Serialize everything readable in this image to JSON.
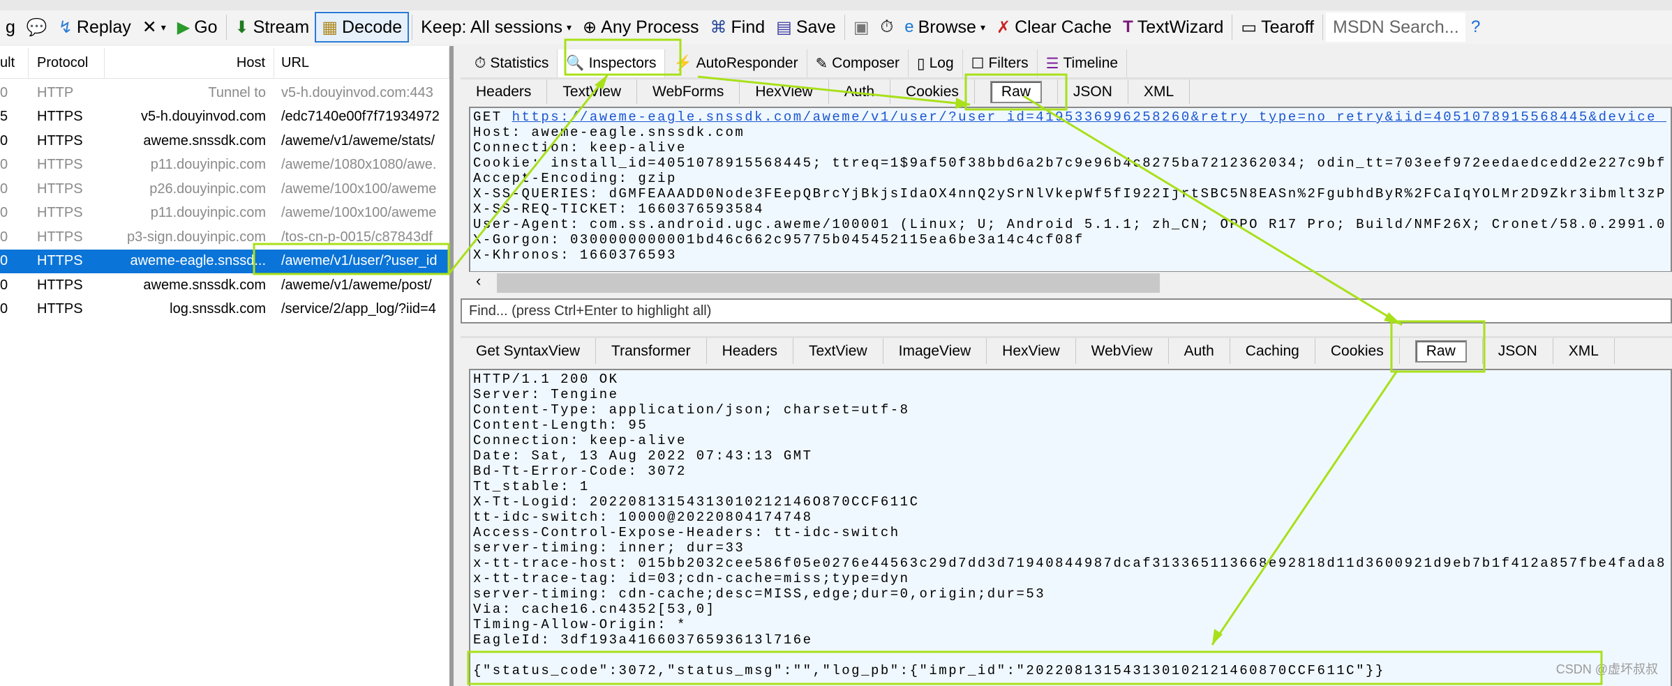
{
  "toolbar": {
    "items": [
      {
        "label": "Replay",
        "icon": "replay-icon"
      },
      {
        "label": "Go",
        "icon": "play-icon"
      },
      {
        "label": "Stream",
        "icon": "stream-icon"
      },
      {
        "label": "Decode",
        "icon": "decode-icon"
      },
      {
        "label": "Keep: All sessions"
      },
      {
        "label": "Any Process",
        "icon": "crosshair-icon"
      },
      {
        "label": "Find",
        "icon": "binoculars-icon"
      },
      {
        "label": "Save",
        "icon": "save-icon"
      },
      {
        "label": "Browse",
        "icon": "ie-icon"
      },
      {
        "label": "Clear Cache",
        "icon": "clear-cache-icon"
      },
      {
        "label": "TextWizard",
        "icon": "textwizard-icon"
      },
      {
        "label": "Tearoff",
        "icon": "tearoff-icon"
      }
    ],
    "partial_g": "g",
    "remove_label": "✕",
    "search_placeholder": "MSDN Search..."
  },
  "sessions": {
    "columns": [
      "ult",
      "Protocol",
      "Host",
      "URL"
    ],
    "rows": [
      {
        "result": "0",
        "protocol": "HTTP",
        "host": "Tunnel to",
        "url": "v5-h.douyinvod.com:443",
        "muted": true
      },
      {
        "result": "5",
        "protocol": "HTTPS",
        "host": "v5-h.douyinvod.com",
        "url": "/edc7140e00f7f71934972",
        "muted": false
      },
      {
        "result": "0",
        "protocol": "HTTPS",
        "host": "aweme.snssdk.com",
        "url": "/aweme/v1/aweme/stats/",
        "muted": false
      },
      {
        "result": "0",
        "protocol": "HTTPS",
        "host": "p11.douyinpic.com",
        "url": "/aweme/1080x1080/awe.",
        "muted": true
      },
      {
        "result": "0",
        "protocol": "HTTPS",
        "host": "p26.douyinpic.com",
        "url": "/aweme/100x100/aweme",
        "muted": true
      },
      {
        "result": "0",
        "protocol": "HTTPS",
        "host": "p11.douyinpic.com",
        "url": "/aweme/100x100/aweme",
        "muted": true
      },
      {
        "result": "0",
        "protocol": "HTTPS",
        "host": "p3-sign.douyinpic.com",
        "url": "/tos-cn-p-0015/c87843df",
        "muted": true
      },
      {
        "result": "0",
        "protocol": "HTTPS",
        "host": "aweme-eagle.snssd...",
        "url": "/aweme/v1/user/?user_id",
        "muted": false,
        "selected": true
      },
      {
        "result": "0",
        "protocol": "HTTPS",
        "host": "aweme.snssdk.com",
        "url": "/aweme/v1/aweme/post/",
        "muted": false
      },
      {
        "result": "0",
        "protocol": "HTTPS",
        "host": "log.snssdk.com",
        "url": "/service/2/app_log/?iid=4",
        "muted": false
      }
    ]
  },
  "main_tabs": [
    {
      "label": "Statistics",
      "icon": "stopwatch-icon"
    },
    {
      "label": "Inspectors",
      "icon": "magnifier-icon",
      "active": true
    },
    {
      "label": "AutoResponder",
      "icon": "lightning-icon"
    },
    {
      "label": "Composer",
      "icon": "composer-icon"
    },
    {
      "label": "Log",
      "icon": "log-icon"
    },
    {
      "label": "Filters",
      "icon": "filter-icon"
    },
    {
      "label": "Timeline",
      "icon": "timeline-icon"
    }
  ],
  "request": {
    "tabs": [
      "Headers",
      "TextView",
      "WebForms",
      "HexView",
      "Auth",
      "Cookies",
      "Raw",
      "JSON",
      "XML"
    ],
    "active": "Raw",
    "method": "GET ",
    "url": "https://aweme-eagle.snssdk.com/aweme/v1/user/?user_id=4195336996258260&retry_type=no_retry&iid=4051078915568445&device_",
    "lines": [
      "Host: aweme-eagle.snssdk.com",
      "Connection: keep-alive",
      "Cookie: install_id=4051078915568445; ttreq=1$9af50f38bbd6a2b7c9e96b4c8275ba7212362034; odin_tt=703eef972eedaedcedd2e227c9bf",
      "Accept-Encoding: gzip",
      "X-SS-QUERIES: dGMFEAAADD0Node3FEepQBrcYjBkjsIdaOX4nnQ2ySrNlVkepWf5fI922IjrtSBC5N8EASn%2FgubhdByR%2FCaIqYOLMr2D9Zkr3ibmlt3zP",
      "X-SS-REQ-TICKET: 1660376593584",
      "User-Agent: com.ss.android.ugc.aweme/100001 (Linux; U; Android 5.1.1; zh_CN; OPPO R17 Pro; Build/NMF26X; Cronet/58.0.2991.0",
      "X-Gorgon: 0300000000001bd46c662c95775b045452115ea6be3a14c4cf08f",
      "X-Khronos: 1660376593"
    ],
    "find_placeholder": "Find... (press Ctrl+Enter to highlight all)"
  },
  "response": {
    "tabs": [
      "Get SyntaxView",
      "Transformer",
      "Headers",
      "TextView",
      "ImageView",
      "HexView",
      "WebView",
      "Auth",
      "Caching",
      "Cookies",
      "Raw",
      "JSON",
      "XML"
    ],
    "active": "Raw",
    "lines": [
      "HTTP/1.1 200 OK",
      "Server: Tengine",
      "Content-Type: application/json; charset=utf-8",
      "Content-Length: 95",
      "Connection: keep-alive",
      "Date: Sat, 13 Aug 2022 07:43:13 GMT",
      "Bd-Tt-Error-Code: 3072",
      "Tt_stable: 1",
      "X-Tt-Logid: 20220813154313010212146O870CCF611C",
      "tt-idc-switch: 10000@20220804174748",
      "Access-Control-Expose-Headers: tt-idc-switch",
      "server-timing: inner; dur=33",
      "x-tt-trace-host: 015bb2032cee586f05e0276e44563c29d7dd3d71940844987dcaf313365113668e92818d11d3600921d9eb7b1f412a857fbe4fada8",
      "x-tt-trace-tag: id=03;cdn-cache=miss;type=dyn",
      "server-timing: cdn-cache;desc=MISS,edge;dur=0,origin;dur=53",
      "Via: cache16.cn4352[53,0]",
      "Timing-Allow-Origin: *",
      "EagleId: 3df193a41660376593613l716e"
    ],
    "body": "{\"status_code\":3072,\"status_msg\":\"\",\"log_pb\":{\"impr_id\":\"202208131543130102121460870CCF611C\"}}"
  },
  "watermark": "CSDN @虚坏叔叔",
  "colors": {
    "annotation": "#a8e01a",
    "selection": "#0a74d8",
    "text_bg": "#f0f8ff"
  }
}
